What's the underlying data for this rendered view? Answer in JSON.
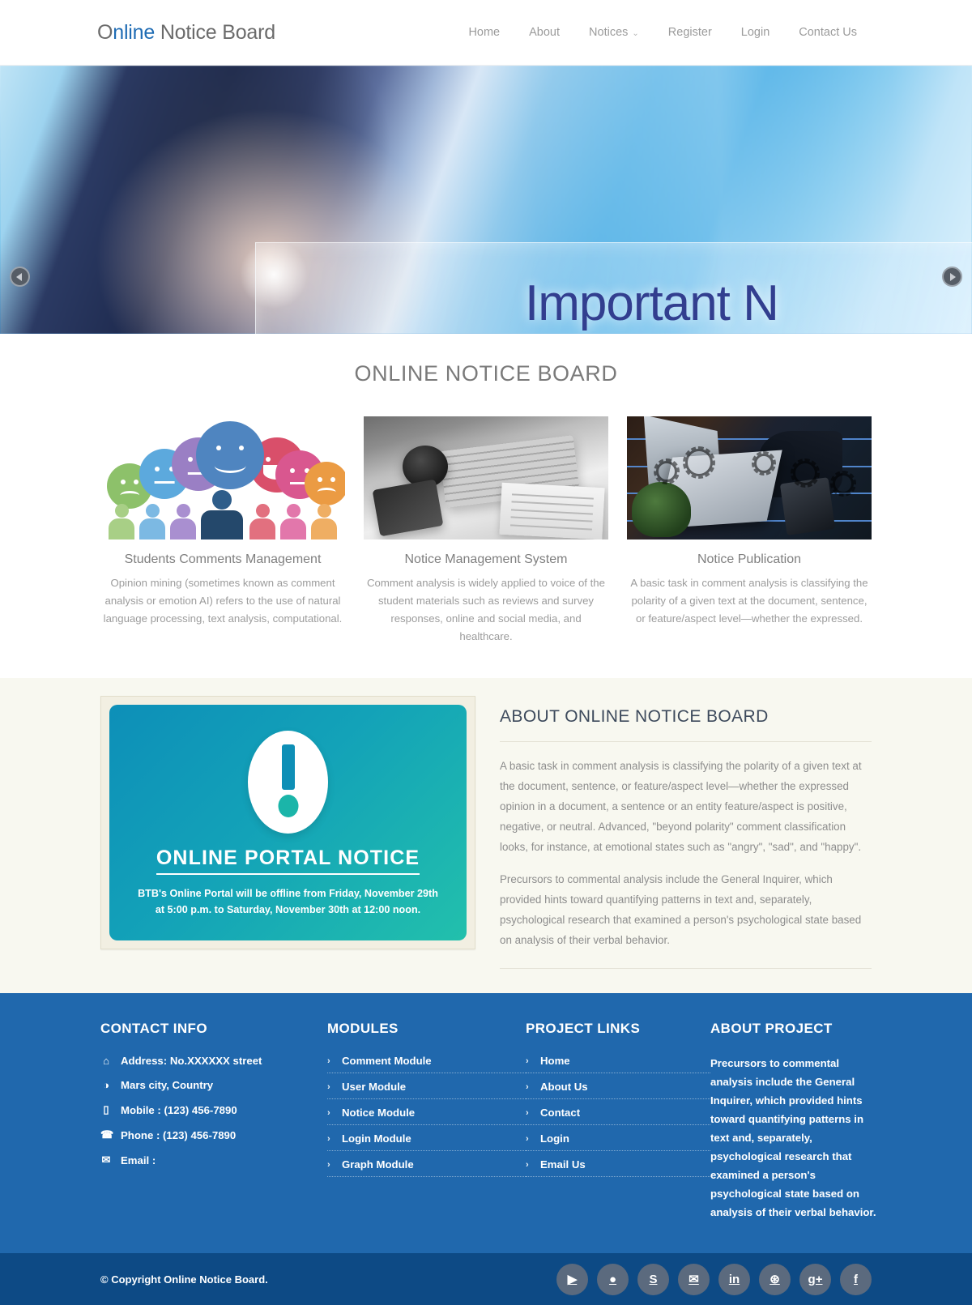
{
  "header": {
    "brand_prefix": "O",
    "brand_mid": "nline",
    "brand_suffix": " Notice Board",
    "nav": [
      {
        "label": "Home",
        "has_caret": false
      },
      {
        "label": "About",
        "has_caret": false
      },
      {
        "label": "Notices",
        "has_caret": true
      },
      {
        "label": "Register",
        "has_caret": false
      },
      {
        "label": "Login",
        "has_caret": false
      },
      {
        "label": "Contact Us",
        "has_caret": false
      }
    ],
    "caret_glyph": "⌄"
  },
  "hero": {
    "caption": "Important N",
    "prev_label": "Previous slide",
    "next_label": "Next slide"
  },
  "features": {
    "section_title": "ONLINE NOTICE BOARD",
    "cards": [
      {
        "title": "Students Comments Management",
        "text": "Opinion mining (sometimes known as comment analysis or emotion AI) refers to the use of natural language processing, text analysis, computational.",
        "image_name": "speech-bubbles-people-illustration"
      },
      {
        "title": "Notice Management System",
        "text": "Comment analysis is widely applied to voice of the student materials such as reviews and survey responses, online and social media, and healthcare.",
        "image_name": "desk-keyboard-photo"
      },
      {
        "title": "Notice Publication",
        "text": "A basic task in comment analysis is classifying the polarity of a given text at the document, sentence, or feature/aspect level—whether the expressed.",
        "image_name": "laptop-tech-photo"
      }
    ]
  },
  "about": {
    "notice_card": {
      "heading": "ONLINE PORTAL NOTICE",
      "body_line1": "BTB's Online Portal will be offline from Friday, November 29th",
      "body_line2": "at 5:00 p.m. to Saturday, November 30th at 12:00 noon.",
      "icon_name": "exclamation-mark"
    },
    "title": "ABOUT ONLINE NOTICE BOARD",
    "paragraph1": "A basic task in comment analysis is classifying the polarity of a given text at the document, sentence, or feature/aspect level—whether the expressed opinion in a document, a sentence or an entity feature/aspect is positive, negative, or neutral. Advanced, \"beyond polarity\" comment classification looks, for instance, at emotional states such as \"angry\", \"sad\", and \"happy\".",
    "paragraph2": "Precursors to commental analysis include the General Inquirer, which provided hints toward quantifying patterns in text and, separately, psychological research that examined a person's psychological state based on analysis of their verbal behavior."
  },
  "footer": {
    "contact": {
      "title": "CONTACT INFO",
      "items": [
        {
          "icon": "home-icon",
          "glyph": "⌂",
          "text": "Address: No.XXXXXX street"
        },
        {
          "icon": "globe-icon",
          "glyph": "◑",
          "text": "Mars city, Country"
        },
        {
          "icon": "mobile-icon",
          "glyph": "▯",
          "text": "Mobile : (123) 456-7890"
        },
        {
          "icon": "phone-icon",
          "glyph": "☎",
          "text": "Phone : (123) 456-7890"
        },
        {
          "icon": "envelope-icon",
          "glyph": "✉",
          "text": "Email :"
        }
      ]
    },
    "modules": {
      "title": "MODULES",
      "items": [
        "Comment Module",
        "User Module",
        "Notice Module",
        "Login Module",
        "Graph Module"
      ]
    },
    "project_links": {
      "title": "PROJECT LINKS",
      "items": [
        "Home",
        "About Us",
        "Contact",
        "Login",
        "Email Us"
      ]
    },
    "about_project": {
      "title": "ABOUT PROJECT",
      "text": "Precursors to commental analysis include the General Inquirer, which provided hints toward quantifying patterns in text and, separately, psychological research that examined a person's psychological state based on analysis of their verbal behavior."
    },
    "chevron_glyph": "›",
    "bottom": {
      "copyright": "© Copyright Online Notice Board.",
      "socials": [
        {
          "name": "youtube-icon",
          "glyph": "▶"
        },
        {
          "name": "github-icon",
          "glyph": "●"
        },
        {
          "name": "skype-icon",
          "glyph": "S"
        },
        {
          "name": "twitter-icon",
          "glyph": "✉"
        },
        {
          "name": "linkedin-icon",
          "glyph": "in"
        },
        {
          "name": "dribbble-icon",
          "glyph": "⊛"
        },
        {
          "name": "googleplus-icon",
          "glyph": "g+"
        },
        {
          "name": "facebook-icon",
          "glyph": "f"
        }
      ]
    }
  },
  "colors": {
    "brand_blue": "#1f6cb4",
    "footer_blue": "#2068ad",
    "footer_bottom_blue": "#0d4a85",
    "about_bg": "#f8f8f0",
    "notice_teal": "#13a2b8",
    "social_gray": "#5b6a7e"
  }
}
